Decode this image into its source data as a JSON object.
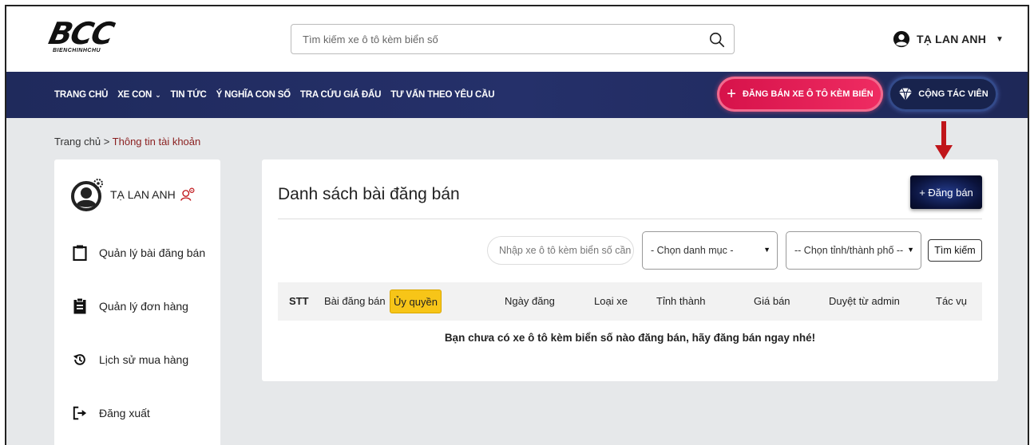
{
  "header": {
    "logo_text": "BCC",
    "logo_sub": "BIENCHINHCHU",
    "search_placeholder": "Tìm kiếm xe ô tô kèm biển số",
    "user_name": "TẠ LAN ANH"
  },
  "nav": {
    "items": [
      "TRANG CHỦ",
      "XE CON",
      "TIN TỨC",
      "Ý NGHĨA CON SỐ",
      "TRA CỨU GIÁ ĐẤU",
      "TƯ VẤN THEO YÊU CẦU"
    ],
    "sell_button": "ĐĂNG BÁN XE Ô TÔ KÈM BIỂN",
    "ctv_button": "CỘNG TÁC VIÊN"
  },
  "breadcrumb": {
    "home": "Trang chủ",
    "separator": ">",
    "current": "Thông tin tài khoản"
  },
  "sidebar": {
    "profile_name": "TẠ LAN ANH",
    "menu": [
      {
        "label": "Quản lý bài đăng bán",
        "icon": "clipboard-icon"
      },
      {
        "label": "Quản lý đơn hàng",
        "icon": "clipboard-list-icon"
      },
      {
        "label": "Lịch sử mua hàng",
        "icon": "history-icon"
      },
      {
        "label": "Đăng xuất",
        "icon": "logout-icon"
      }
    ]
  },
  "panel": {
    "title": "Danh sách bài đăng bán",
    "post_button": "+ Đăng bán",
    "filter_input_placeholder": "Nhập xe ô tô kèm biển số cần tìm",
    "category_select": "- Chọn danh mục -",
    "province_select": "-- Chọn tỉnh/thành phố --",
    "search_button": "Tìm kiếm",
    "columns": [
      "STT",
      "Bài đăng bán",
      "Ủy quyền",
      "Ngày đăng",
      "Loại xe",
      "Tỉnh thành",
      "Giá bán",
      "Duyệt từ admin",
      "Tác vụ"
    ],
    "empty_message": "Bạn chưa có xe ô tô kèm biển số nào đăng bán, hãy đăng bán ngay nhé!"
  },
  "colors": {
    "nav_bg": "#1f2a5c",
    "sell_button": "#e01f55",
    "highlight": "#f7c518",
    "arrow": "#c0151a",
    "breadcrumb_current": "#8a1e1e"
  }
}
